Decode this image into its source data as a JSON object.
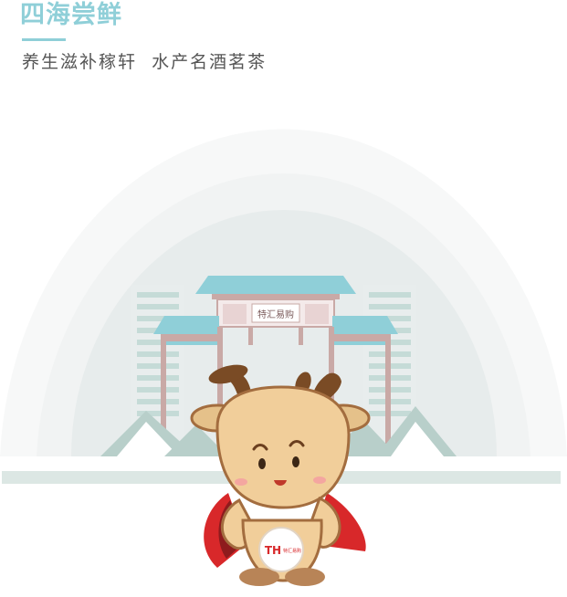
{
  "header": {
    "title": "四海尝鲜",
    "subtitle": "养生滋补稼轩  水产名酒茗茶"
  },
  "illustration": {
    "gate_sign": "特汇易购",
    "mascot_badge": "TH",
    "mascot_badge_sub": "特汇易购"
  },
  "colors": {
    "accent": "#8fcfd8",
    "subtitle_text": "#555555",
    "gate_roof": "#8fcfd8",
    "gate_pillar": "#c9a9a6",
    "mascot_body": "#f1ce9a",
    "mascot_outline": "#a36d3f",
    "cape": "#d8282a"
  }
}
